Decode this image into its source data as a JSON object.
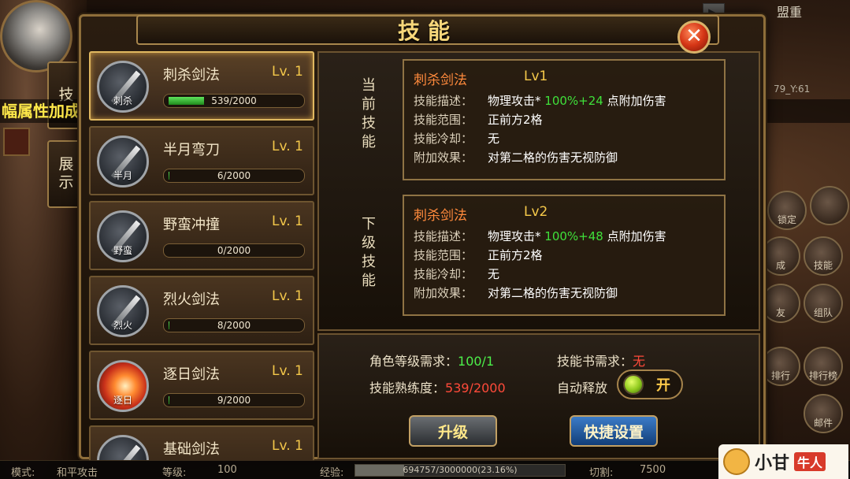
{
  "window": {
    "title": "技能",
    "close_label": "✕"
  },
  "side_tabs": [
    "技",
    "展示"
  ],
  "marquee": "幅属性加成！",
  "map": {
    "coords": "79_Y:61",
    "ally": "盟重"
  },
  "right_buttons": [
    "锁定",
    "技能",
    "组队",
    "排行榜",
    "邮件",
    "成",
    "友",
    "排行"
  ],
  "skills": [
    {
      "name": "刺杀剑法",
      "level": "Lv. 1",
      "progress_text": "539/2000",
      "progress": 0.2695,
      "icon_caption": "刺杀",
      "icon": "sword-icon"
    },
    {
      "name": "半月弯刀",
      "level": "Lv. 1",
      "progress_text": "6/2000",
      "progress": 0.003,
      "icon_caption": "半月",
      "icon": "sword-icon"
    },
    {
      "name": "野蛮冲撞",
      "level": "Lv. 1",
      "progress_text": "0/2000",
      "progress": 0,
      "icon_caption": "野蛮",
      "icon": "charge-icon"
    },
    {
      "name": "烈火剑法",
      "level": "Lv. 1",
      "progress_text": "8/2000",
      "progress": 0.004,
      "icon_caption": "烈火",
      "icon": "sword-icon"
    },
    {
      "name": "逐日剑法",
      "level": "Lv. 1",
      "progress_text": "9/2000",
      "progress": 0.0045,
      "icon_caption": "逐日",
      "icon": "fire-slash-icon"
    },
    {
      "name": "基础剑法",
      "level": "Lv. 1",
      "progress_text": "",
      "progress": 0,
      "icon_caption": "",
      "icon": "sword-icon"
    }
  ],
  "current": {
    "label": "当前技能",
    "name": "刺杀剑法",
    "level": "Lv1",
    "desc_key": "技能描述：",
    "desc_pre": "物理攻击*",
    "desc_green": "100%+24",
    "desc_post": "点附加伤害",
    "range_key": "技能范围：",
    "range": "正前方2格",
    "cooldown_key": "技能冷却：",
    "cooldown": "无",
    "effect_key": "附加效果：",
    "effect": "对第二格的伤害无视防御"
  },
  "next": {
    "label": "下级技能",
    "name": "刺杀剑法",
    "level": "Lv2",
    "desc_key": "技能描述：",
    "desc_pre": "物理攻击*",
    "desc_green": "100%+48",
    "desc_post": "点附加伤害",
    "range_key": "技能范围：",
    "range": "正前方2格",
    "cooldown_key": "技能冷却：",
    "cooldown": "无",
    "effect_key": "附加效果：",
    "effect": "对第二格的伤害无视防御"
  },
  "requirements": {
    "level_label": "角色等级需求：",
    "level_value": "100/1",
    "book_label": "技能书需求：",
    "book_value": "无",
    "mastery_label": "技能熟练度：",
    "mastery_value": "539/2000",
    "auto_label": "自动释放",
    "auto_toggle": "开"
  },
  "buttons": {
    "upgrade": "升级",
    "shortcut": "快捷设置"
  },
  "statusbar": {
    "mode_label": "模式:",
    "mode_value": "和平攻击",
    "level_label": "等级:",
    "level_value": "100",
    "exp_label": "经验:",
    "exp_text": "694757/3000000(23.16%)",
    "exp_progress": 0.2316,
    "cut_label": "切割:",
    "cut_value": "7500"
  },
  "watermark": {
    "brand": "小甘",
    "tag": "牛人"
  },
  "colors": {
    "accent_gold": "#f7d77a",
    "frame": "#8e6e3a",
    "green": "#3fe03a",
    "red": "#ff4a3a"
  }
}
